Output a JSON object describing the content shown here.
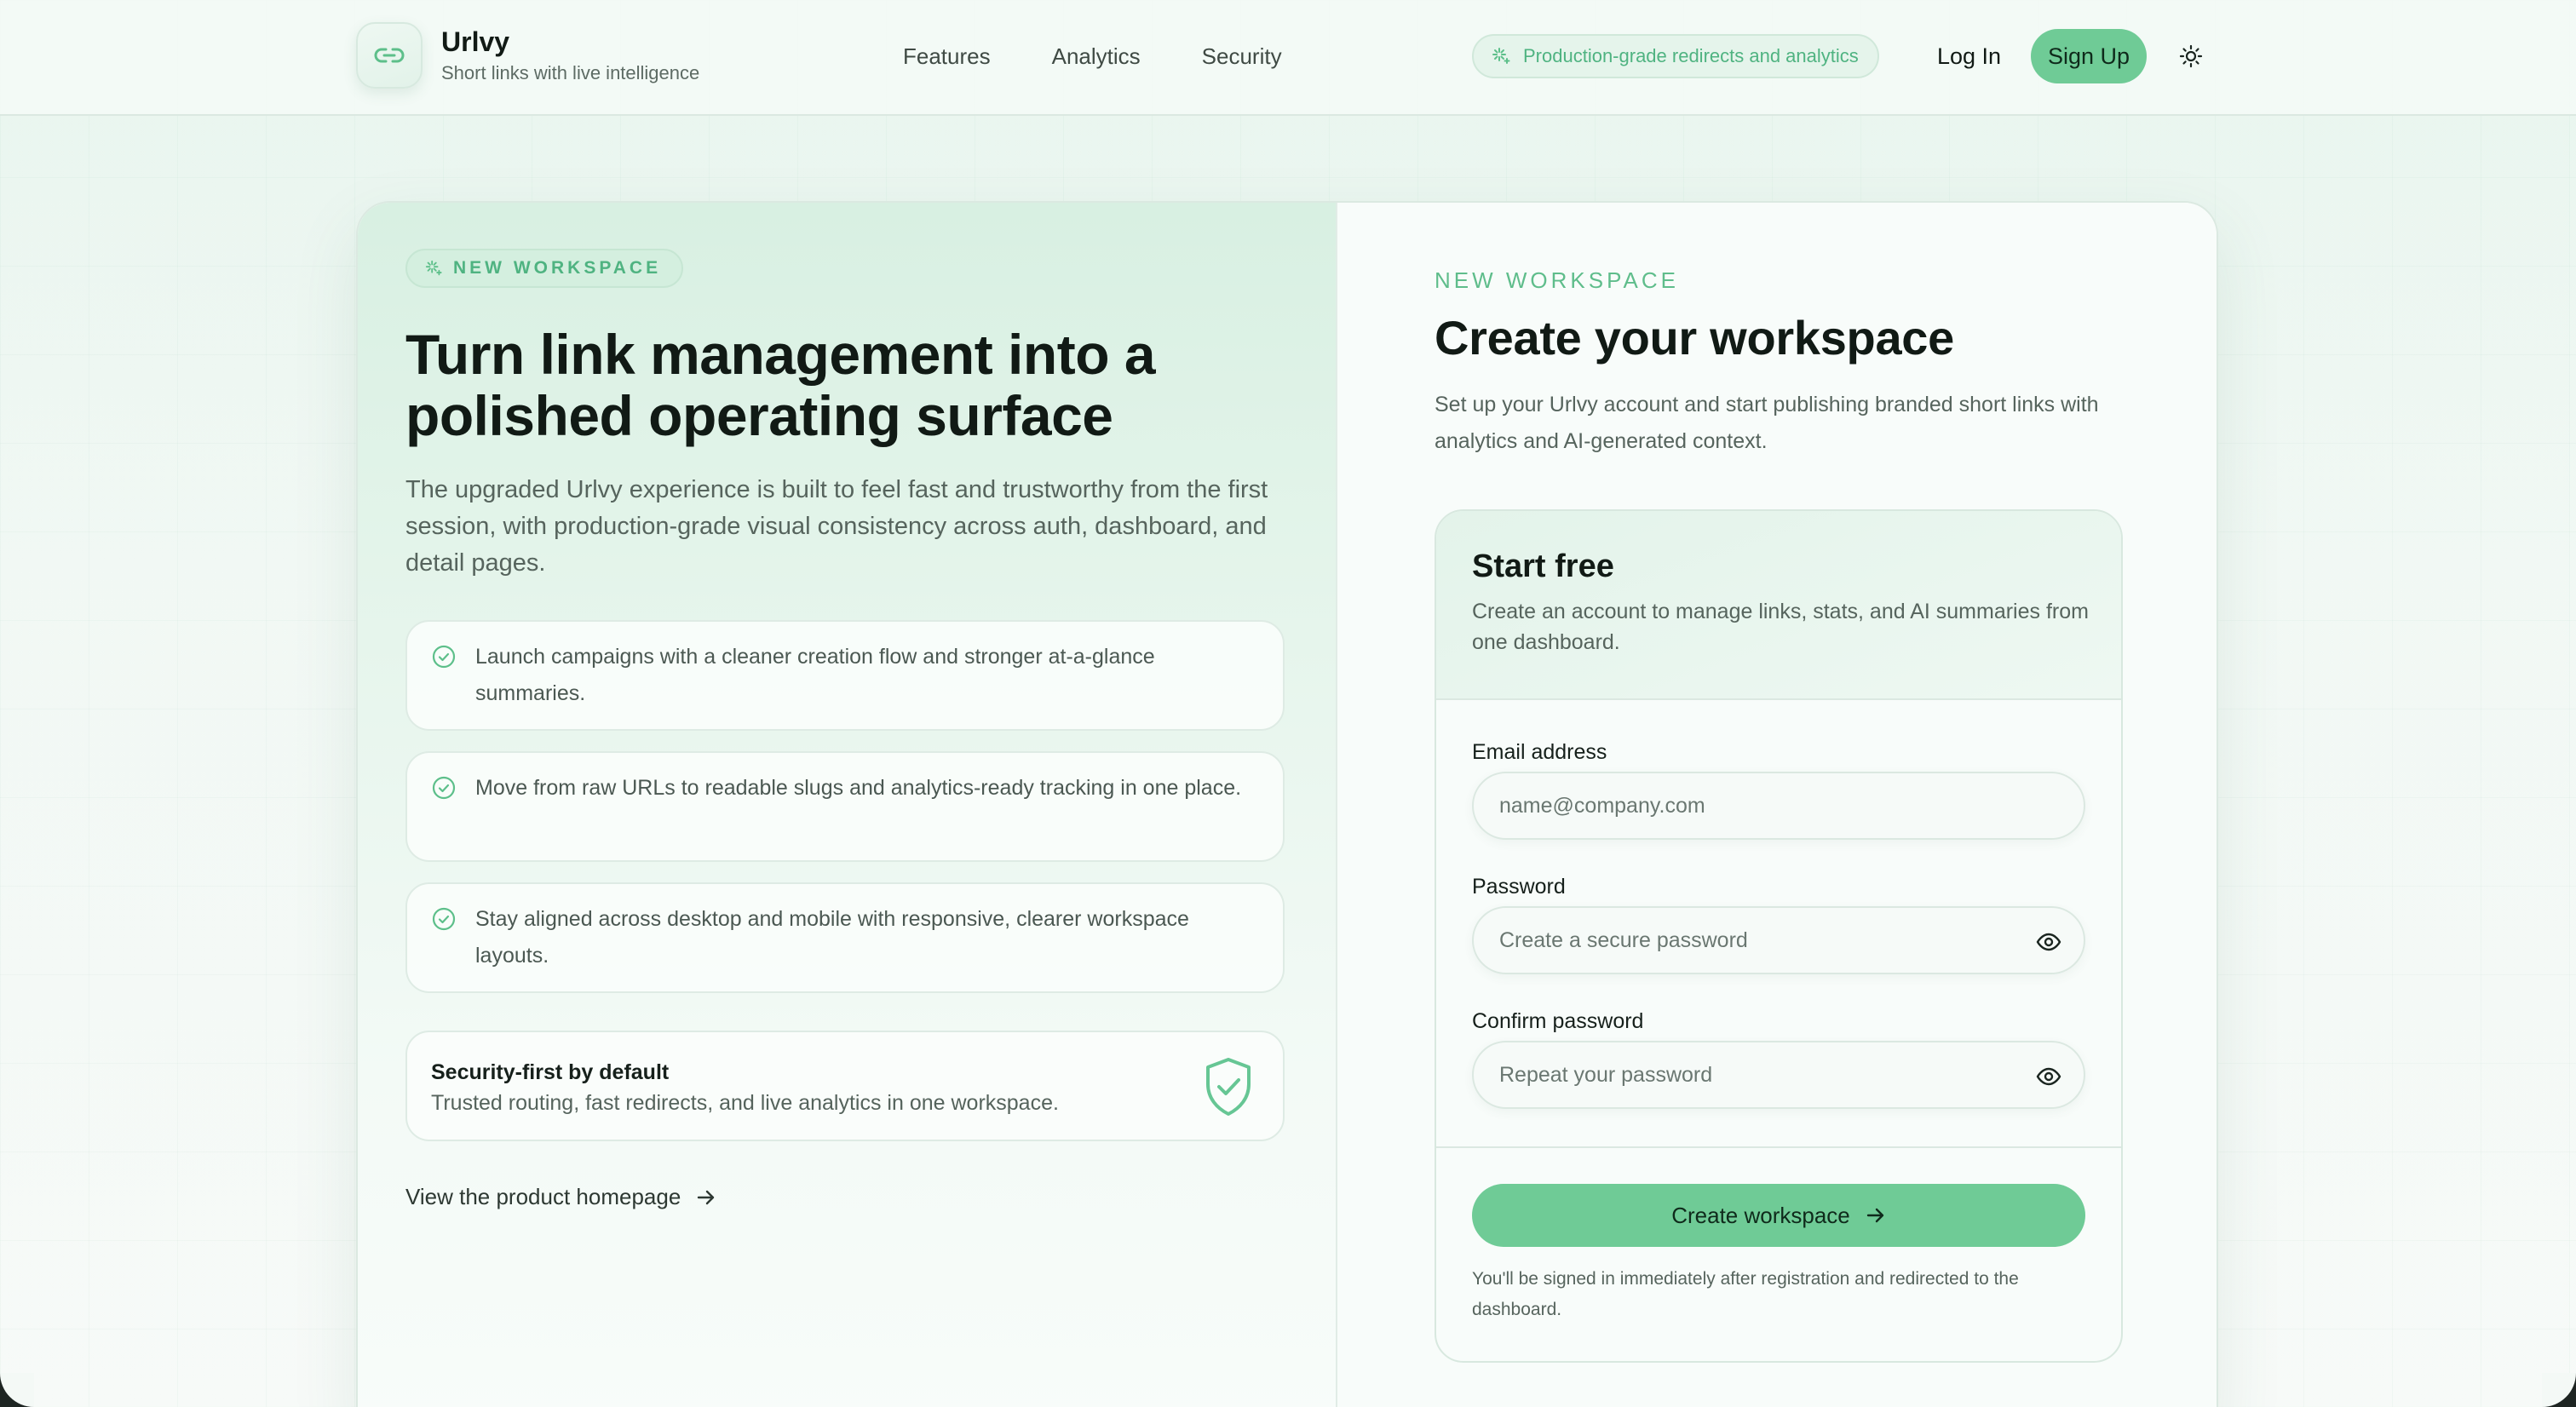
{
  "header": {
    "brand_name": "Urlvy",
    "brand_tagline": "Short links with live intelligence",
    "nav": [
      "Features",
      "Analytics",
      "Security"
    ],
    "badge": "Production-grade redirects and analytics",
    "login": "Log In",
    "signup": "Sign Up"
  },
  "left": {
    "eyebrow": "NEW WORKSPACE",
    "title": "Turn link management into a polished operating surface",
    "description": "The upgraded Urlvy experience is built to feel fast and trustworthy from the first session, with production-grade visual consistency across auth, dashboard, and detail pages.",
    "features": [
      "Launch campaigns with a cleaner creation flow and stronger at-a-glance summaries.",
      "Move from raw URLs to readable slugs and analytics-ready tracking in one place.",
      "Stay aligned across desktop and mobile with responsive, clearer workspace layouts."
    ],
    "security_title": "Security-first by default",
    "security_sub": "Trusted routing, fast redirects, and live analytics in one workspace.",
    "home_link": "View the product homepage"
  },
  "right": {
    "eyebrow": "NEW WORKSPACE",
    "title": "Create your workspace",
    "description": "Set up your Urlvy account and start publishing branded short links with analytics and AI-generated context.",
    "form": {
      "title": "Start free",
      "subtitle": "Create an account to manage links, stats, and AI summaries from one dashboard.",
      "email_label": "Email address",
      "email_placeholder": "name@company.com",
      "password_label": "Password",
      "password_placeholder": "Create a secure password",
      "confirm_label": "Confirm password",
      "confirm_placeholder": "Repeat your password",
      "submit": "Create workspace",
      "note": "You'll be signed in immediately after registration and redirected to the dashboard."
    }
  },
  "colors": {
    "accent": "#6fcb96",
    "accent_text": "#4fb381"
  }
}
